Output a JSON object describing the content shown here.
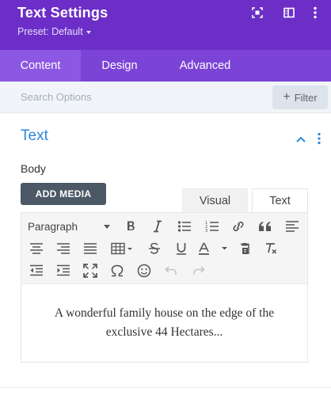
{
  "header": {
    "title": "Text Settings",
    "preset_label": "Preset: Default",
    "bg_color": "#6c2ec7",
    "icons": [
      "fullscreen-icon",
      "sidebar-layout-icon",
      "more-vertical-icon"
    ]
  },
  "tabs": [
    {
      "label": "Content",
      "active": true
    },
    {
      "label": "Design",
      "active": false
    },
    {
      "label": "Advanced",
      "active": false
    }
  ],
  "search": {
    "placeholder": "Search Options",
    "filter_label": "Filter"
  },
  "section": {
    "title": "Text",
    "expanded": true,
    "accent_color": "#2b87da"
  },
  "body_field": {
    "label": "Body",
    "add_media_label": "ADD MEDIA",
    "editor_tabs": [
      {
        "label": "Visual",
        "active": false
      },
      {
        "label": "Text",
        "active": true
      }
    ],
    "toolbar": {
      "format_select": "Paragraph",
      "row1": [
        "bold-icon",
        "italic-icon",
        "bullet-list-icon",
        "numbered-list-icon",
        "link-icon",
        "blockquote-icon",
        "align-left-icon"
      ],
      "row2": [
        "align-center-icon",
        "align-right-icon",
        "align-justify-icon",
        "table-icon",
        "strikethrough-icon",
        "underline-icon",
        "text-color-icon",
        "paste-text-icon",
        "clear-formatting-icon"
      ],
      "row3": [
        "outdent-icon",
        "indent-icon",
        "fullscreen-icon",
        "special-character-icon",
        "emoji-icon",
        "undo-icon",
        "redo-icon"
      ]
    },
    "content": "A wonderful family house on the edge of the exclusive 44 Hectares..."
  }
}
